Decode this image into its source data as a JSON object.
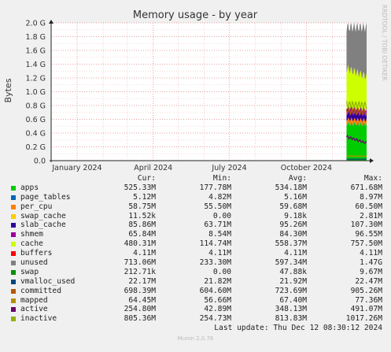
{
  "chart_data": {
    "type": "area",
    "title": "Memory usage - by year",
    "ylabel": "Bytes",
    "side_text": "RRDTOOL / TOBI OETIKER",
    "ylim": [
      0,
      2000000000
    ],
    "y_ticks": [
      {
        "v": 0,
        "label": "0.0"
      },
      {
        "v": 200000000,
        "label": "0.2 G"
      },
      {
        "v": 400000000,
        "label": "0.4 G"
      },
      {
        "v": 600000000,
        "label": "0.6 G"
      },
      {
        "v": 800000000,
        "label": "0.8 G"
      },
      {
        "v": 1000000000,
        "label": "1.0 G"
      },
      {
        "v": 1200000000,
        "label": "1.2 G"
      },
      {
        "v": 1400000000,
        "label": "1.4 G"
      },
      {
        "v": 1600000000,
        "label": "1.6 G"
      },
      {
        "v": 1800000000,
        "label": "1.8 G"
      },
      {
        "v": 2000000000,
        "label": "2.0 G"
      }
    ],
    "x_range": [
      "2023-12-01",
      "2024-12-12"
    ],
    "x_ticks": [
      {
        "date": "2024-01-01",
        "label": "January 2024"
      },
      {
        "date": "2024-04-01",
        "label": "April 2024"
      },
      {
        "date": "2024-07-01",
        "label": "July 2024"
      },
      {
        "date": "2024-10-01",
        "label": "October 2024"
      }
    ],
    "data_start": "2024-11-18",
    "stack_series": [
      "apps",
      "page_tables",
      "per_cpu",
      "swap_cache",
      "slab_cache",
      "shmem",
      "cache",
      "buffers",
      "unused",
      "swap"
    ],
    "line_series": [
      "vmalloc_used",
      "committed",
      "mapped",
      "active",
      "inactive"
    ],
    "series": [
      {
        "name": "apps",
        "color": "#00cc00",
        "cur": "525.33M",
        "min": "177.78M",
        "avg": "534.18M",
        "max": "671.68M"
      },
      {
        "name": "page_tables",
        "color": "#0066b3",
        "cur": "5.12M",
        "min": "4.82M",
        "avg": "5.16M",
        "max": "8.97M"
      },
      {
        "name": "per_cpu",
        "color": "#ff8000",
        "cur": "58.75M",
        "min": "55.50M",
        "avg": "59.68M",
        "max": "60.50M"
      },
      {
        "name": "swap_cache",
        "color": "#ffcc00",
        "cur": "11.52k",
        "min": "0.00",
        "avg": "9.18k",
        "max": "2.81M"
      },
      {
        "name": "slab_cache",
        "color": "#330099",
        "cur": "85.86M",
        "min": "63.71M",
        "avg": "95.26M",
        "max": "107.30M"
      },
      {
        "name": "shmem",
        "color": "#990099",
        "cur": "65.84M",
        "min": "8.54M",
        "avg": "84.30M",
        "max": "96.55M"
      },
      {
        "name": "cache",
        "color": "#ccff00",
        "cur": "480.31M",
        "min": "114.74M",
        "avg": "558.37M",
        "max": "757.50M"
      },
      {
        "name": "buffers",
        "color": "#ff0000",
        "cur": "4.11M",
        "min": "4.11M",
        "avg": "4.11M",
        "max": "4.11M"
      },
      {
        "name": "unused",
        "color": "#808080",
        "cur": "713.06M",
        "min": "233.30M",
        "avg": "597.34M",
        "max": "1.47G"
      },
      {
        "name": "swap",
        "color": "#008f00",
        "cur": "212.71k",
        "min": "0.00",
        "avg": "47.88k",
        "max": "9.67M"
      },
      {
        "name": "vmalloc_used",
        "color": "#00487d",
        "cur": "22.17M",
        "min": "21.82M",
        "avg": "21.92M",
        "max": "22.47M"
      },
      {
        "name": "committed",
        "color": "#b35a00",
        "cur": "698.39M",
        "min": "604.60M",
        "avg": "723.69M",
        "max": "905.26M"
      },
      {
        "name": "mapped",
        "color": "#b38f00",
        "cur": "64.45M",
        "min": "56.66M",
        "avg": "67.40M",
        "max": "77.36M"
      },
      {
        "name": "active",
        "color": "#6b006b",
        "cur": "254.80M",
        "min": "42.89M",
        "avg": "348.13M",
        "max": "491.07M"
      },
      {
        "name": "inactive",
        "color": "#8fb300",
        "cur": "805.36M",
        "min": "254.73M",
        "avg": "813.83M",
        "max": "1017.26M"
      }
    ]
  },
  "legend": {
    "col_cur": "Cur:",
    "col_min": "Min:",
    "col_avg": "Avg:",
    "col_max": "Max:",
    "last_update": "Last update: Thu Dec 12 08:30:12 2024"
  },
  "footer": "Munin 2.0.76"
}
